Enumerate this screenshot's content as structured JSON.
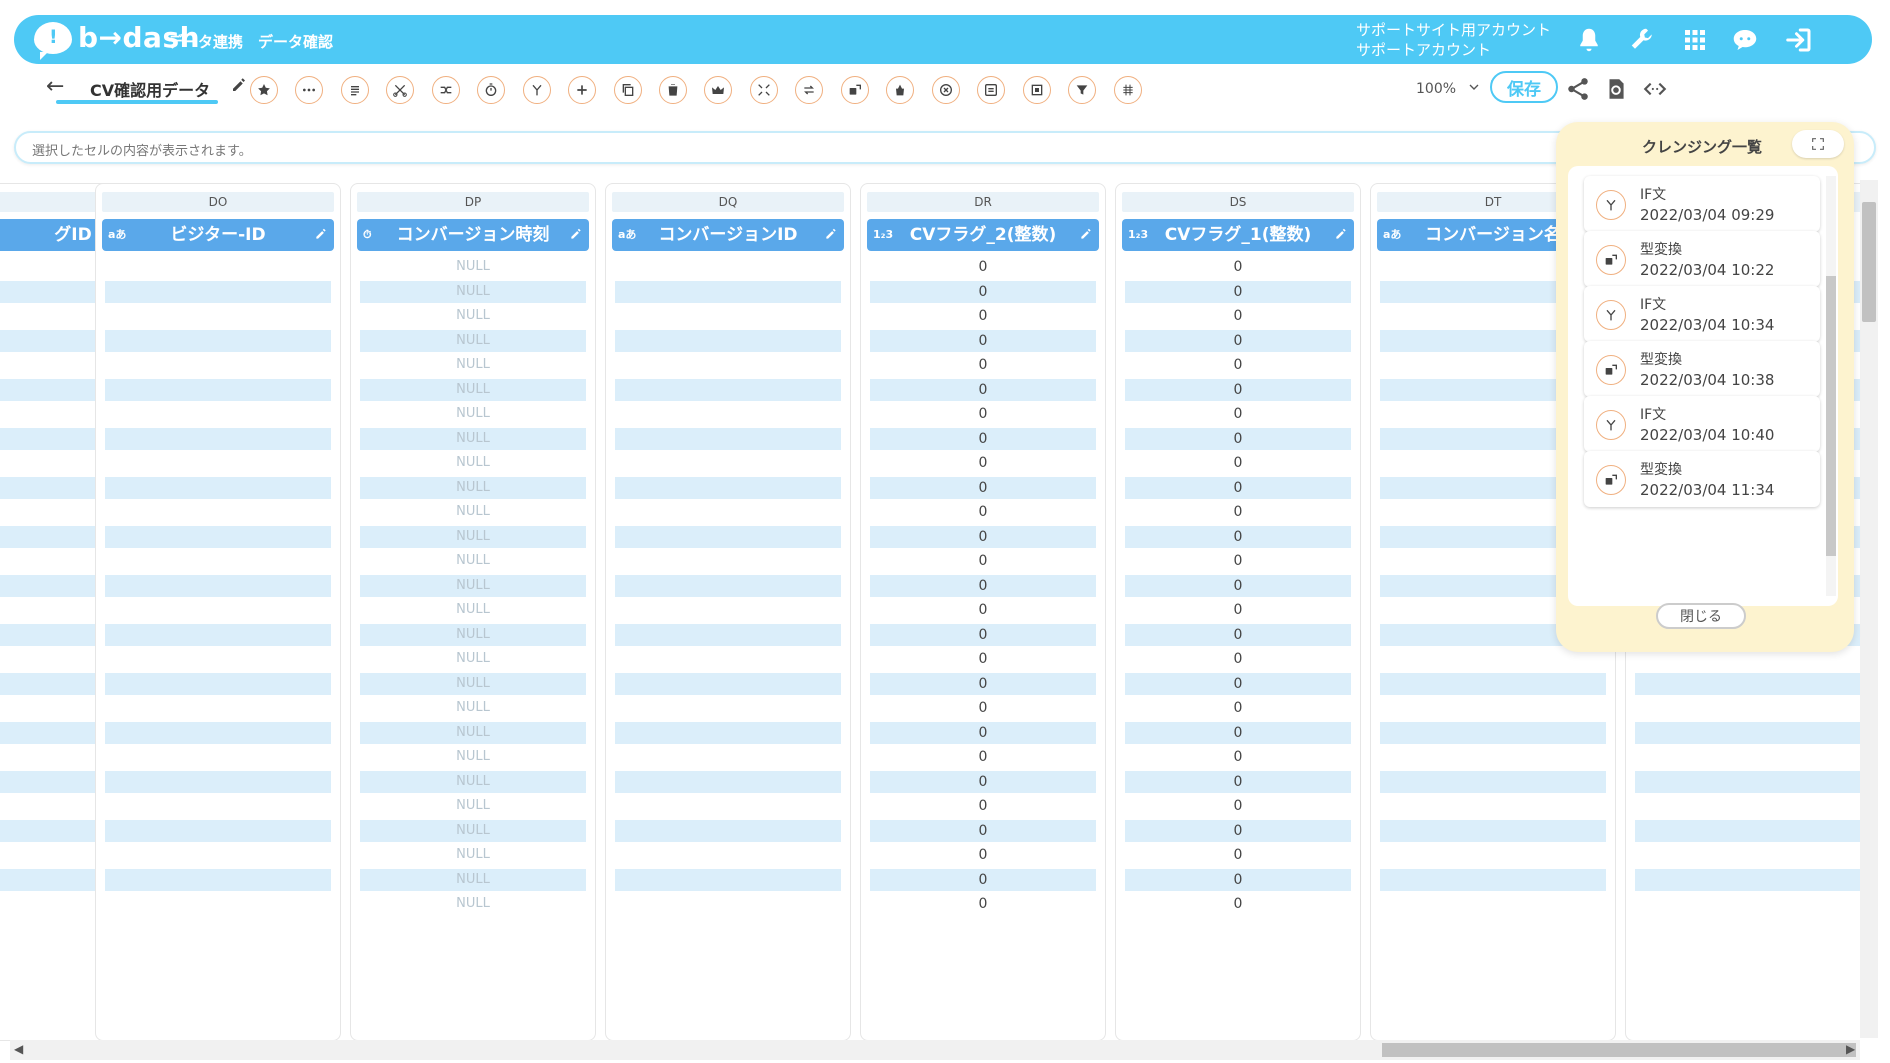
{
  "header": {
    "logo_text": "b→dash",
    "logo_mark": "!",
    "nav": [
      "データ連携",
      "データ確認"
    ],
    "account_line1": "サポートサイト用アカウント",
    "account_line2": "サポートアカウント"
  },
  "toolbar": {
    "title": "CV確認用データ",
    "zoom": "100%",
    "save_label": "保存"
  },
  "cellbar": {
    "placeholder": "選択したセルの内容が表示されます。"
  },
  "columns": [
    {
      "letter": "",
      "type": "",
      "name": "グID"
    },
    {
      "letter": "DO",
      "type": "aあ",
      "name": "ビジター-ID"
    },
    {
      "letter": "DP",
      "type": "⏱",
      "name": "コンバージョン時刻"
    },
    {
      "letter": "DQ",
      "type": "aあ",
      "name": "コンバージョンID"
    },
    {
      "letter": "DR",
      "type": "1₂3",
      "name": "CVフラグ_2(整数)"
    },
    {
      "letter": "DS",
      "type": "1₂3",
      "name": "CVフラグ_1(整数)"
    },
    {
      "letter": "DT",
      "type": "aあ",
      "name": "コンバージョン名"
    },
    {
      "letter": "",
      "type": "",
      "name": ""
    }
  ],
  "cells": {
    "null_text": "NULL",
    "zero_text": "0"
  },
  "panel": {
    "title": "クレンジング一覧",
    "close_label": "閉じる",
    "items": [
      {
        "name": "IF文",
        "date": "2022/03/04 09:29",
        "icon": "branch-icon"
      },
      {
        "name": "型変換",
        "date": "2022/03/04 10:22",
        "icon": "convert-icon"
      },
      {
        "name": "IF文",
        "date": "2022/03/04 10:34",
        "icon": "branch-icon"
      },
      {
        "name": "型変換",
        "date": "2022/03/04 10:38",
        "icon": "convert-icon"
      },
      {
        "name": "IF文",
        "date": "2022/03/04 10:40",
        "icon": "branch-icon"
      },
      {
        "name": "型変換",
        "date": "2022/03/04 11:34",
        "icon": "convert-icon"
      }
    ]
  },
  "colors": {
    "header": "#4ec9f5",
    "column_header": "#5aa8ea",
    "row_stripe": "#dbeefa",
    "panel_bg": "#fdf3cf",
    "tool_border": "#f0b080"
  }
}
